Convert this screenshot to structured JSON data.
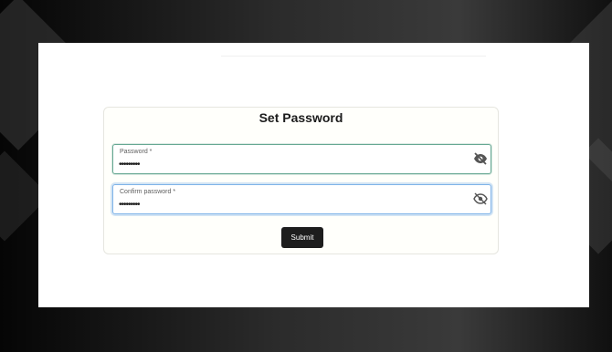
{
  "card": {
    "title": "Set Password",
    "password": {
      "label": "Password *",
      "value": "•••••••••",
      "icon": "eye-slash-icon"
    },
    "confirm_password": {
      "label": "Confirm password *",
      "value": "•••••••••",
      "icon": "eye-icon"
    },
    "submit_label": "Submit"
  }
}
